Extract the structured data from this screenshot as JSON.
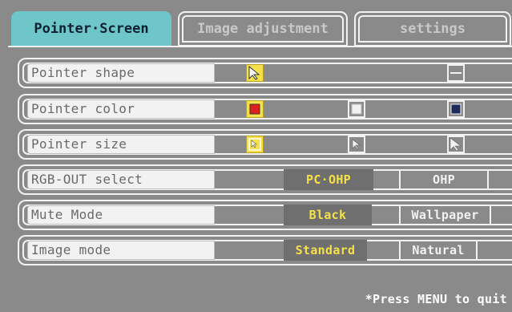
{
  "tabs": [
    {
      "label": "Pointer·Screen",
      "active": true
    },
    {
      "label": "Image adjustment",
      "active": false
    },
    {
      "label": "settings",
      "active": false
    }
  ],
  "rows": {
    "pointer_shape": {
      "label": "Pointer shape",
      "options": [
        "arrow-pointer-icon",
        "bar-pointer-icon"
      ],
      "selected": 0
    },
    "pointer_color": {
      "label": "Pointer color",
      "options": [
        "red-swatch-icon",
        "white-swatch-icon",
        "navy-swatch-icon"
      ],
      "selected": 0
    },
    "pointer_size": {
      "label": "Pointer size",
      "options": [
        "small-pointer-icon",
        "medium-pointer-icon",
        "large-pointer-icon"
      ],
      "selected": 0
    },
    "rgb_out": {
      "label": "RGB-OUT select",
      "options": [
        "PC·OHP",
        "OHP"
      ],
      "selected": 0
    },
    "mute_mode": {
      "label": "Mute Mode",
      "options": [
        "Black",
        "Wallpaper"
      ],
      "selected": 0
    },
    "image_mode": {
      "label": "Image mode",
      "options": [
        "Standard",
        "Natural"
      ],
      "selected": 0
    }
  },
  "footer": "*Press MENU to quit",
  "colors": {
    "background": "#8a8a8a",
    "active_tab": "#6ec6c9",
    "selected_highlight": "#f4e04a",
    "red_swatch": "#e0201c",
    "navy_swatch": "#1e2a5a"
  }
}
